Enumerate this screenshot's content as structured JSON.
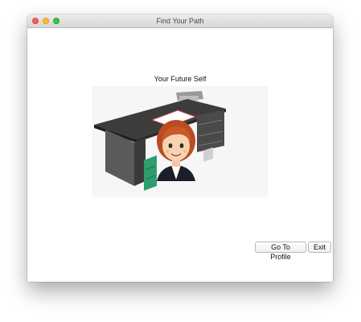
{
  "window": {
    "title": "Find Your Path"
  },
  "main": {
    "heading": "Your Future Self",
    "image_icon": "woman-at-desk-illustration"
  },
  "buttons": {
    "go_to_profile": "Go To Profile",
    "exit": "Exit"
  },
  "colors": {
    "close": "#fc5b57",
    "minimize": "#fdbc2e",
    "maximize": "#33c748",
    "desk": "#3c3c3c",
    "hair": "#c8592a",
    "cabinet_green": "#2f9d6e"
  }
}
